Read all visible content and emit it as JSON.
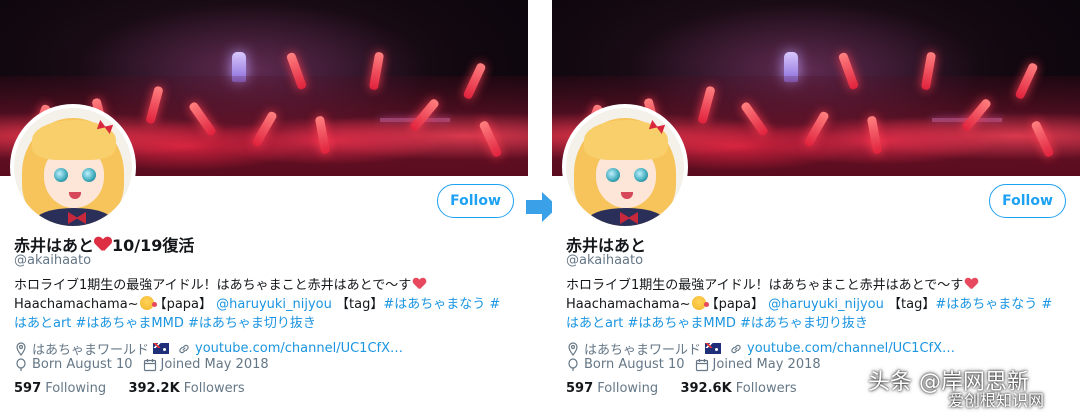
{
  "panels": [
    {
      "follow_label": "Follow",
      "name": "赤井はあと",
      "name_suffix": "10/19復活",
      "handle": "@akaihaato",
      "bio": {
        "line1_text": "ホロライブ1期生の最強アイドル！はあちゃまこと赤井はあとで〜す",
        "line2_text": "Haachamachama~",
        "line2_papa": "【papa】",
        "line2_mention": "@haruyuki_nijyou",
        "line2_tag": "【tag】",
        "line2_hashtag": "#はあちゃまなう #",
        "line3_hashtags": "はあとart #はあちゃまMMD #はあちゃま切り抜き"
      },
      "location": "はあちゃまワールド",
      "website": "youtube.com/channel/UC1CfX…",
      "born": "Born August 10",
      "joined": "Joined May 2018",
      "following_count": "597",
      "following_label": "Following",
      "followers_count": "392.2K",
      "followers_label": "Followers"
    },
    {
      "follow_label": "Follow",
      "name": "赤井はあと",
      "handle": "@akaihaato",
      "bio": {
        "line1_text": "ホロライブ1期生の最強アイドル！はあちゃまこと赤井はあとで〜す",
        "line2_text": "Haachamachama~",
        "line2_papa": "【papa】",
        "line2_mention": "@haruyuki_nijyou",
        "line2_tag": "【tag】",
        "line2_hashtag": "#はあちゃまなう #",
        "line3_hashtags": "はあとart #はあちゃまMMD #はあちゃま切り抜き"
      },
      "location": "はあちゃまワールド",
      "website": "youtube.com/channel/UC1CfX…",
      "born": "Born August 10",
      "joined": "Joined May 2018",
      "following_count": "597",
      "following_label": "Following",
      "followers_count": "392.6K",
      "followers_label": "Followers"
    }
  ],
  "watermark": {
    "main": "头条 @岸网思新",
    "sub": "爱创根知识网"
  },
  "colors": {
    "accent": "#1da1f2",
    "link": "#1b95e0",
    "muted": "#657786",
    "heart": "#dd2e44",
    "arrow": "#3aa0e8"
  }
}
